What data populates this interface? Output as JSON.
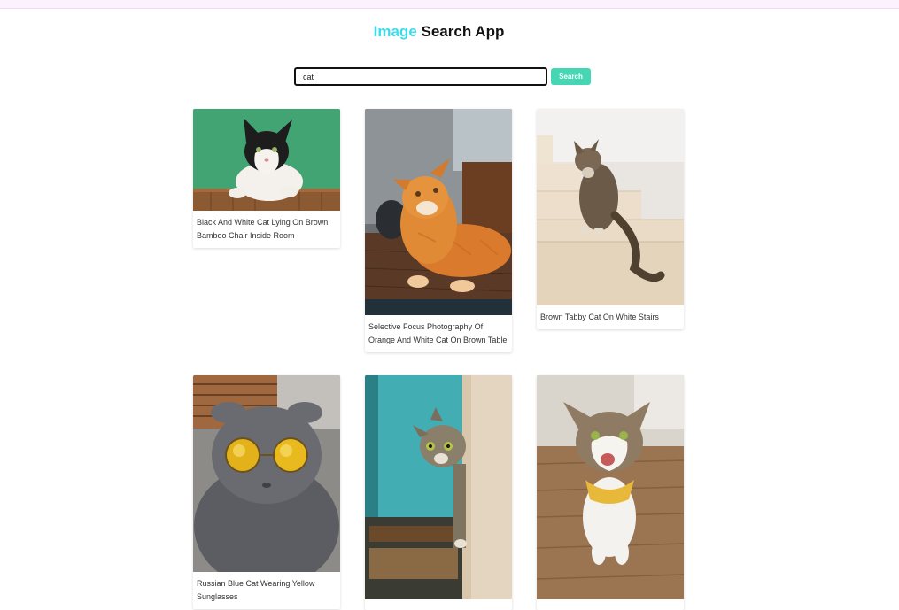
{
  "app": {
    "title_accent": "Image",
    "title_rest": " Search App",
    "accent_color": "#3ddbe8"
  },
  "search": {
    "value": "cat",
    "button_label": "Search",
    "button_color": "#45d7b3"
  },
  "results": [
    {
      "caption": "Black And White Cat Lying On Brown Bamboo Chair Inside Room"
    },
    {
      "caption": "Selective Focus Photography Of Orange And White Cat On Brown Table"
    },
    {
      "caption": "Brown Tabby Cat On White Stairs"
    },
    {
      "caption": "Russian Blue Cat Wearing Yellow Sunglasses"
    },
    {
      "caption": ""
    },
    {
      "caption": ""
    }
  ]
}
